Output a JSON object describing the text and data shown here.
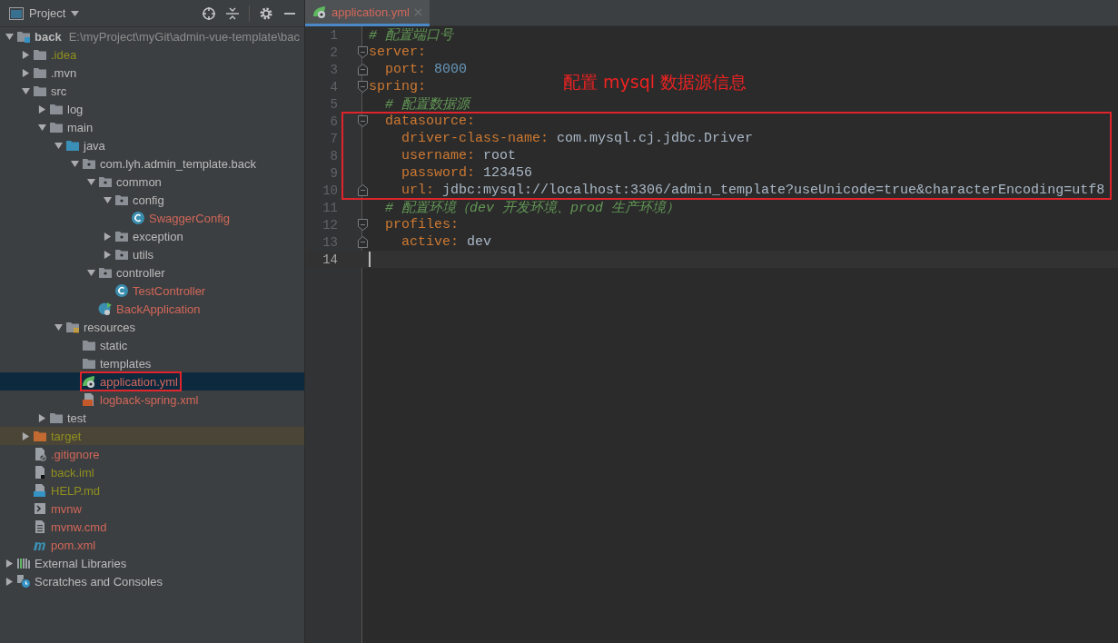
{
  "project_panel": {
    "title": "Project",
    "tree": [
      {
        "label": "back",
        "path": "E:\\myProject\\myGit\\admin-vue-template\\bac",
        "kind": "module",
        "unversioned": false,
        "ignored": false,
        "expanded": true,
        "selected": false,
        "children": [
          {
            "label": ".idea",
            "kind": "folder",
            "unversioned": false,
            "ignored": true,
            "expanded": false,
            "selected": false
          },
          {
            "label": ".mvn",
            "kind": "folder",
            "unversioned": false,
            "ignored": false,
            "expanded": false,
            "selected": false
          },
          {
            "label": "src",
            "kind": "folder",
            "unversioned": false,
            "ignored": false,
            "expanded": true,
            "selected": false,
            "children": [
              {
                "label": "log",
                "kind": "folder",
                "unversioned": false,
                "ignored": false,
                "expanded": false,
                "selected": false
              },
              {
                "label": "main",
                "kind": "folder",
                "unversioned": false,
                "ignored": false,
                "expanded": true,
                "selected": false,
                "children": [
                  {
                    "label": "java",
                    "kind": "source",
                    "unversioned": false,
                    "ignored": false,
                    "expanded": true,
                    "selected": false,
                    "children": [
                      {
                        "label": "com.lyh.admin_template.back",
                        "kind": "package",
                        "unversioned": false,
                        "ignored": false,
                        "expanded": true,
                        "selected": false,
                        "children": [
                          {
                            "label": "common",
                            "kind": "package",
                            "unversioned": false,
                            "ignored": false,
                            "expanded": true,
                            "selected": false,
                            "children": [
                              {
                                "label": "config",
                                "kind": "package",
                                "unversioned": false,
                                "ignored": false,
                                "expanded": true,
                                "selected": false,
                                "children": [
                                  {
                                    "label": "SwaggerConfig",
                                    "kind": "class",
                                    "unversioned": true,
                                    "ignored": false,
                                    "selected": false
                                  }
                                ]
                              },
                              {
                                "label": "exception",
                                "kind": "package",
                                "unversioned": false,
                                "ignored": false,
                                "expanded": false,
                                "selected": false
                              },
                              {
                                "label": "utils",
                                "kind": "package",
                                "unversioned": false,
                                "ignored": false,
                                "expanded": false,
                                "selected": false
                              }
                            ]
                          },
                          {
                            "label": "controller",
                            "kind": "package",
                            "unversioned": false,
                            "ignored": false,
                            "expanded": true,
                            "selected": false,
                            "children": [
                              {
                                "label": "TestController",
                                "kind": "class",
                                "unversioned": true,
                                "ignored": false,
                                "selected": false
                              }
                            ]
                          },
                          {
                            "label": "BackApplication",
                            "kind": "spring-class",
                            "unversioned": true,
                            "ignored": false,
                            "selected": false
                          }
                        ]
                      }
                    ]
                  },
                  {
                    "label": "resources",
                    "kind": "resources",
                    "unversioned": false,
                    "ignored": false,
                    "expanded": true,
                    "selected": false,
                    "children": [
                      {
                        "label": "static",
                        "kind": "folder",
                        "unversioned": false,
                        "ignored": false,
                        "selected": false
                      },
                      {
                        "label": "templates",
                        "kind": "folder",
                        "unversioned": false,
                        "ignored": false,
                        "selected": false
                      },
                      {
                        "label": "application.yml",
                        "kind": "spring-yml",
                        "unversioned": true,
                        "ignored": false,
                        "selected": true,
                        "annotated": true
                      },
                      {
                        "label": "logback-spring.xml",
                        "kind": "xml",
                        "unversioned": true,
                        "ignored": false,
                        "selected": false
                      }
                    ]
                  }
                ]
              },
              {
                "label": "test",
                "kind": "folder",
                "unversioned": false,
                "ignored": false,
                "expanded": false,
                "selected": false
              }
            ]
          },
          {
            "label": "target",
            "kind": "excluded",
            "unversioned": false,
            "ignored": true,
            "expanded": false,
            "selected": false,
            "excluded": true
          },
          {
            "label": ".gitignore",
            "kind": "gitignore",
            "unversioned": true,
            "ignored": false,
            "selected": false
          },
          {
            "label": "back.iml",
            "kind": "iml",
            "unversioned": false,
            "ignored": true,
            "selected": false
          },
          {
            "label": "HELP.md",
            "kind": "md",
            "unversioned": false,
            "ignored": true,
            "selected": false
          },
          {
            "label": "mvnw",
            "kind": "shell",
            "unversioned": true,
            "ignored": false,
            "selected": false
          },
          {
            "label": "mvnw.cmd",
            "kind": "text",
            "unversioned": true,
            "ignored": false,
            "selected": false
          },
          {
            "label": "pom.xml",
            "kind": "maven",
            "unversioned": true,
            "ignored": false,
            "selected": false
          }
        ]
      },
      {
        "label": "External Libraries",
        "kind": "libraries",
        "unversioned": false,
        "ignored": false,
        "expanded": false,
        "selected": false
      },
      {
        "label": "Scratches and Consoles",
        "kind": "scratches",
        "unversioned": false,
        "ignored": false,
        "expanded": false,
        "selected": false
      }
    ]
  },
  "editor": {
    "tabs": [
      {
        "label": "application.yml",
        "unversioned": true,
        "selected": true
      }
    ],
    "callout": "配置 mysql 数据源信息",
    "lines": [
      {
        "number": "1",
        "tokens": [
          {
            "kind": "comment",
            "text": "# 配置端口号"
          }
        ]
      },
      {
        "number": "2",
        "fold_start": true,
        "tokens": [
          {
            "kind": "key",
            "text": "server:"
          }
        ]
      },
      {
        "number": "3",
        "fold_end": true,
        "tokens": [
          {
            "kind": "key",
            "text": "  port:"
          },
          {
            "kind": "number",
            "text": " 8000"
          }
        ]
      },
      {
        "number": "4",
        "fold_start": true,
        "tokens": [
          {
            "kind": "key",
            "text": "spring:"
          }
        ]
      },
      {
        "number": "5",
        "tokens": [
          {
            "kind": "comment",
            "text": "  # 配置数据源"
          }
        ]
      },
      {
        "number": "6",
        "fold_start": true,
        "boxed": true,
        "tokens": [
          {
            "kind": "key",
            "text": "  datasource:"
          }
        ]
      },
      {
        "number": "7",
        "boxed": true,
        "tokens": [
          {
            "kind": "key",
            "text": "    driver-class-name:"
          },
          {
            "kind": "value",
            "text": " com.mysql.cj.jdbc.Driver"
          }
        ]
      },
      {
        "number": "8",
        "boxed": true,
        "tokens": [
          {
            "kind": "key",
            "text": "    username:"
          },
          {
            "kind": "plain",
            "text": " root"
          }
        ]
      },
      {
        "number": "9",
        "boxed": true,
        "tokens": [
          {
            "kind": "key",
            "text": "    password:"
          },
          {
            "kind": "plain",
            "text": " 123456"
          }
        ]
      },
      {
        "number": "10",
        "fold_end": true,
        "boxed": true,
        "tokens": [
          {
            "kind": "key",
            "text": "    url:"
          },
          {
            "kind": "value",
            "text": " jdbc:mysql://localhost:3306/admin_template?useUnicode=true&characterEncoding=utf8"
          }
        ]
      },
      {
        "number": "11",
        "tokens": [
          {
            "kind": "comment",
            "text": "  # 配置环境（dev 开发环境、prod 生产环境）"
          }
        ]
      },
      {
        "number": "12",
        "fold_start": true,
        "tokens": [
          {
            "kind": "key",
            "text": "  profiles:"
          }
        ]
      },
      {
        "number": "13",
        "fold_end": true,
        "tokens": [
          {
            "kind": "key",
            "text": "    active:"
          },
          {
            "kind": "plain",
            "text": " dev"
          }
        ]
      },
      {
        "number": "14",
        "current": true
      }
    ]
  }
}
